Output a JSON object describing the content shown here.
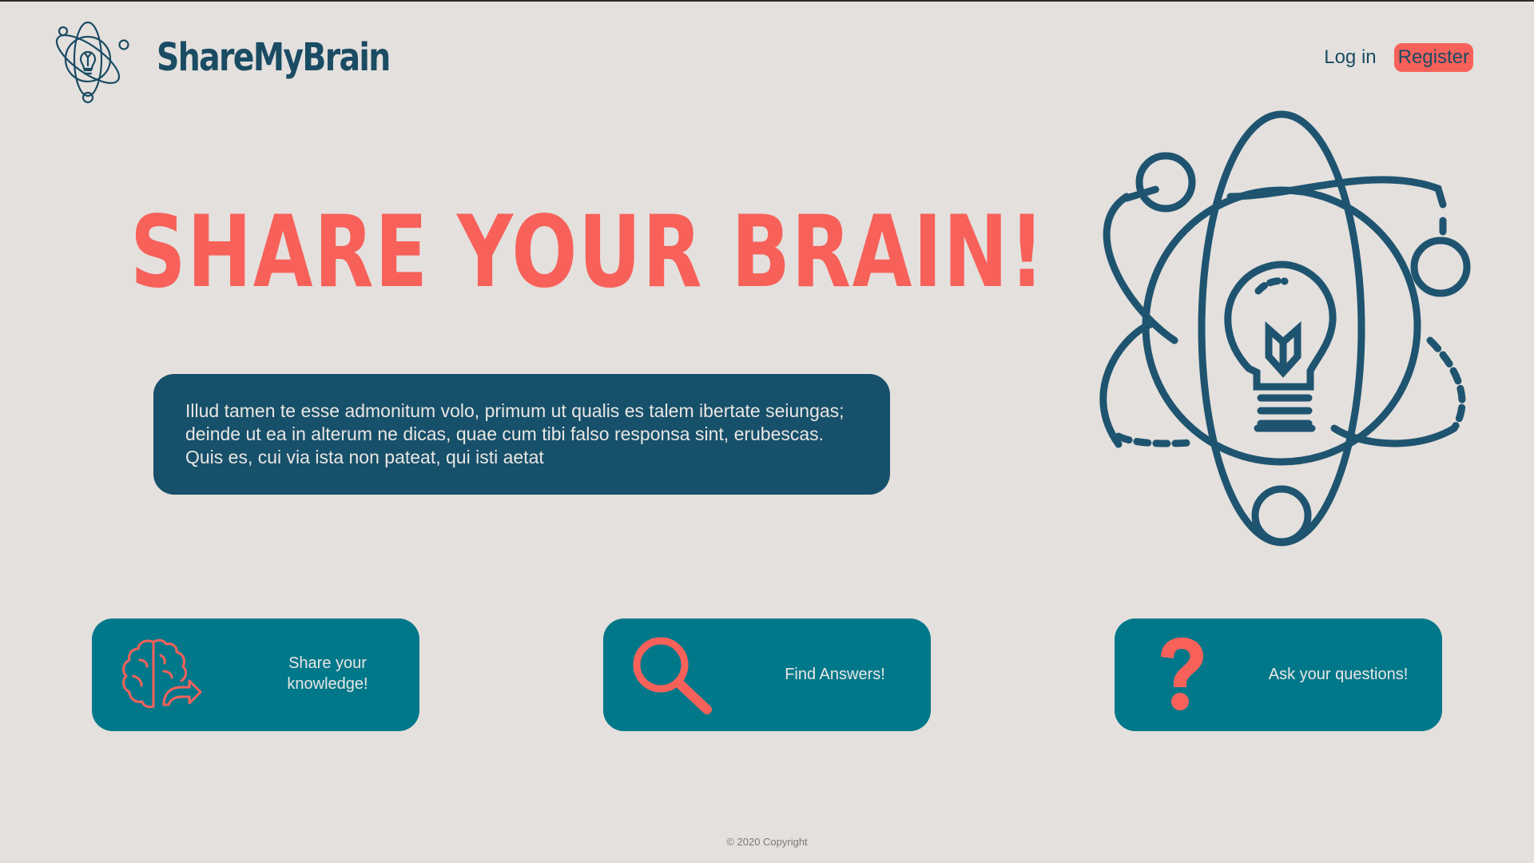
{
  "header": {
    "brand": "ShareMyBrain",
    "logo_icon": "atom-lightbulb-icon",
    "nav": {
      "login_label": "Log in",
      "register_label": "Register"
    }
  },
  "hero": {
    "title": "SHARE YOUR BRAIN!",
    "description": "Illud tamen te esse admonitum volo, primum ut qualis es talem ibertate seiungas; deinde ut ea in alterum ne dicas, quae cum tibi falso responsa sint, erubescas. Quis es, cui via ista non pateat, qui isti aetat",
    "illustration": "atom-lightbulb-illustration"
  },
  "features": [
    {
      "label": "Share your knowledge!",
      "icon": "brain-share-icon"
    },
    {
      "label": "Find Answers!",
      "icon": "magnifier-icon"
    },
    {
      "label": "Ask your questions!",
      "icon": "question-mark-icon"
    }
  ],
  "footer": {
    "copyright": "© 2020 Copyright"
  },
  "colors": {
    "background": "#e4e0dd",
    "primary_dark": "#1a4c64",
    "accent": "#f7615a",
    "card_teal": "#00788a",
    "hero_box": "#17506a"
  }
}
